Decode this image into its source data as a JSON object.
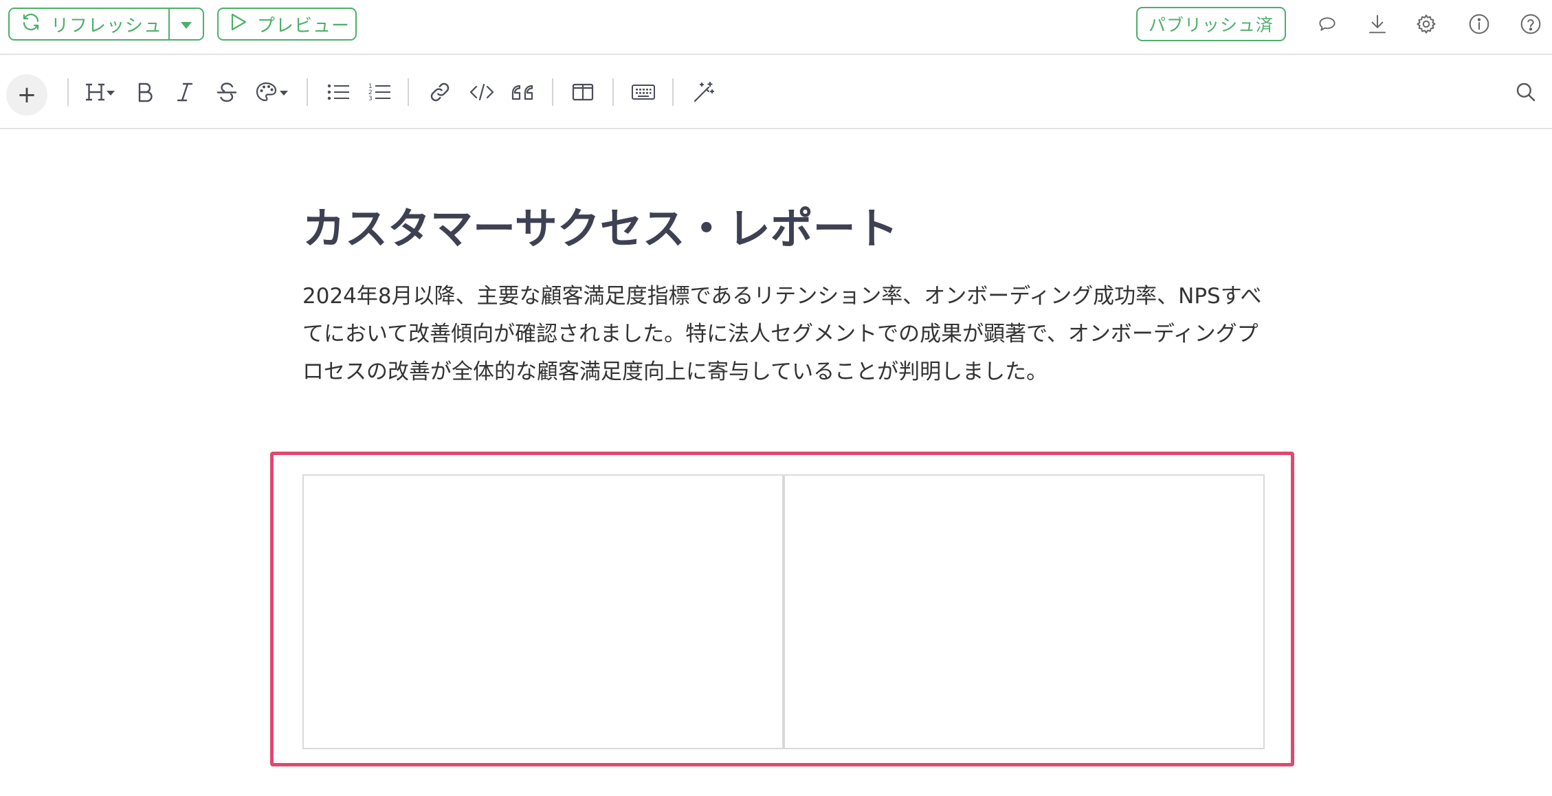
{
  "topbar": {
    "refresh_label": "リフレッシュ",
    "preview_label": "プレビュー",
    "publish_label": "パブリッシュ済",
    "icons": [
      "refresh-icon",
      "caret-down-icon",
      "play-icon",
      "comment-icon",
      "download-icon",
      "gear-icon",
      "info-icon",
      "help-icon"
    ]
  },
  "toolbar": {
    "plus_label": "+",
    "tools": [
      "heading-icon",
      "bold-icon",
      "italic-icon",
      "strikethrough-icon",
      "palette-icon",
      "bullet-list-icon",
      "numbered-list-icon",
      "link-icon",
      "code-icon",
      "quote-icon",
      "columns-icon",
      "keyboard-icon",
      "magic-wand-icon",
      "search-icon"
    ]
  },
  "document": {
    "title": "カスタマーサクセス・レポート",
    "body": "2024年8月以降、主要な顧客満足度指標であるリテンション率、オンボーディング成功率、NPSすべてにおいて改善傾向が確認されました。特に法人セグメントでの成果が顕著で、オンボーディングプロセスの改善が全体的な顧客満足度向上に寄与していることが判明しました。"
  },
  "colors": {
    "accent_green": "#4caf6a",
    "highlight_pink": "#e0486f",
    "title_text": "#3d4152"
  }
}
